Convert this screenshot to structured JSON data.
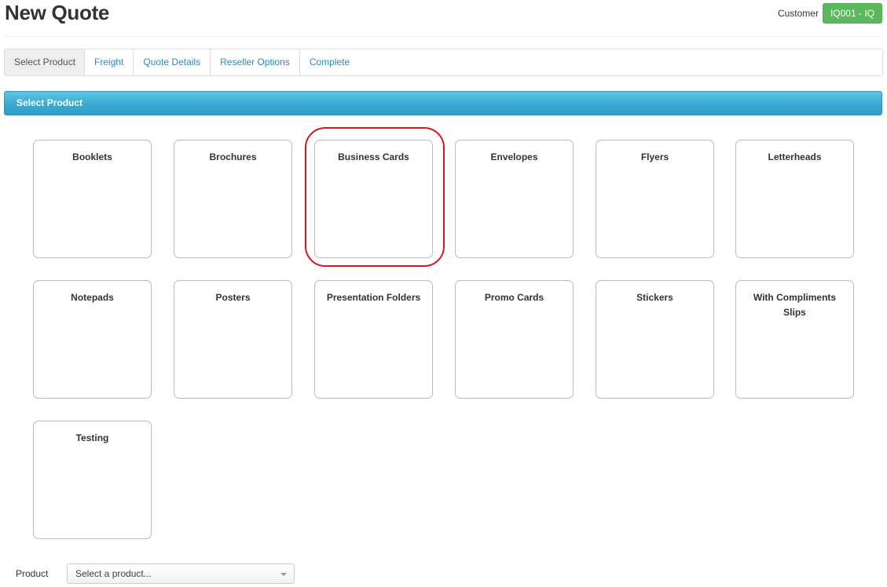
{
  "header": {
    "title": "New Quote",
    "customer_label": "Customer",
    "customer_value": "IQ001 - IQ"
  },
  "tabs": [
    {
      "label": "Select Product",
      "active": true
    },
    {
      "label": "Freight",
      "active": false
    },
    {
      "label": "Quote Details",
      "active": false
    },
    {
      "label": "Reseller Options",
      "active": false
    },
    {
      "label": "Complete",
      "active": false
    }
  ],
  "panel": {
    "title": "Select Product"
  },
  "products": [
    "Booklets",
    "Brochures",
    "Business Cards",
    "Envelopes",
    "Flyers",
    "Letterheads",
    "Notepads",
    "Posters",
    "Presentation Folders",
    "Promo Cards",
    "Stickers",
    "With Compliments Slips",
    "Testing"
  ],
  "highlighted_product": "Business Cards",
  "product_field": {
    "label": "Product",
    "placeholder": "Select a product..."
  },
  "colors": {
    "customer_badge": "#5cb85c",
    "panel_header": "#3aaad1",
    "tab_link": "#2a8ac4",
    "highlight_ring": "#d9141b"
  }
}
